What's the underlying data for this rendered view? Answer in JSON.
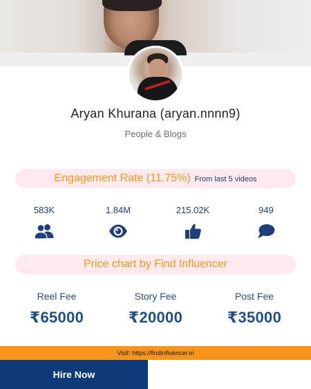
{
  "profile": {
    "name": "Aryan Khurana (aryan.nnnn9)",
    "category": "People & Blogs"
  },
  "engagement": {
    "title": "Engagement Rate (11.75%)",
    "subtitle": "From last 5 videos"
  },
  "stats": [
    {
      "value": "583K",
      "icon": "users-icon"
    },
    {
      "value": "1.84M",
      "icon": "eye-icon"
    },
    {
      "value": "215.02K",
      "icon": "thumbs-up-icon"
    },
    {
      "value": "949",
      "icon": "comment-icon"
    }
  ],
  "price_chart": {
    "title": "Price chart by Find Influencer",
    "fees": [
      {
        "label": "Reel Fee",
        "value": "₹65000"
      },
      {
        "label": "Story Fee",
        "value": "₹20000"
      },
      {
        "label": "Post Fee",
        "value": "₹35000"
      }
    ]
  },
  "footer": {
    "visit_text": "Visit: https://findinfluencer.in",
    "hire_label": "Hire Now"
  },
  "colors": {
    "accent_orange": "#f7941d",
    "navy": "#0d3b7a",
    "stat_blue": "#1f3e7a",
    "pill_bg": "#fde9ee"
  }
}
